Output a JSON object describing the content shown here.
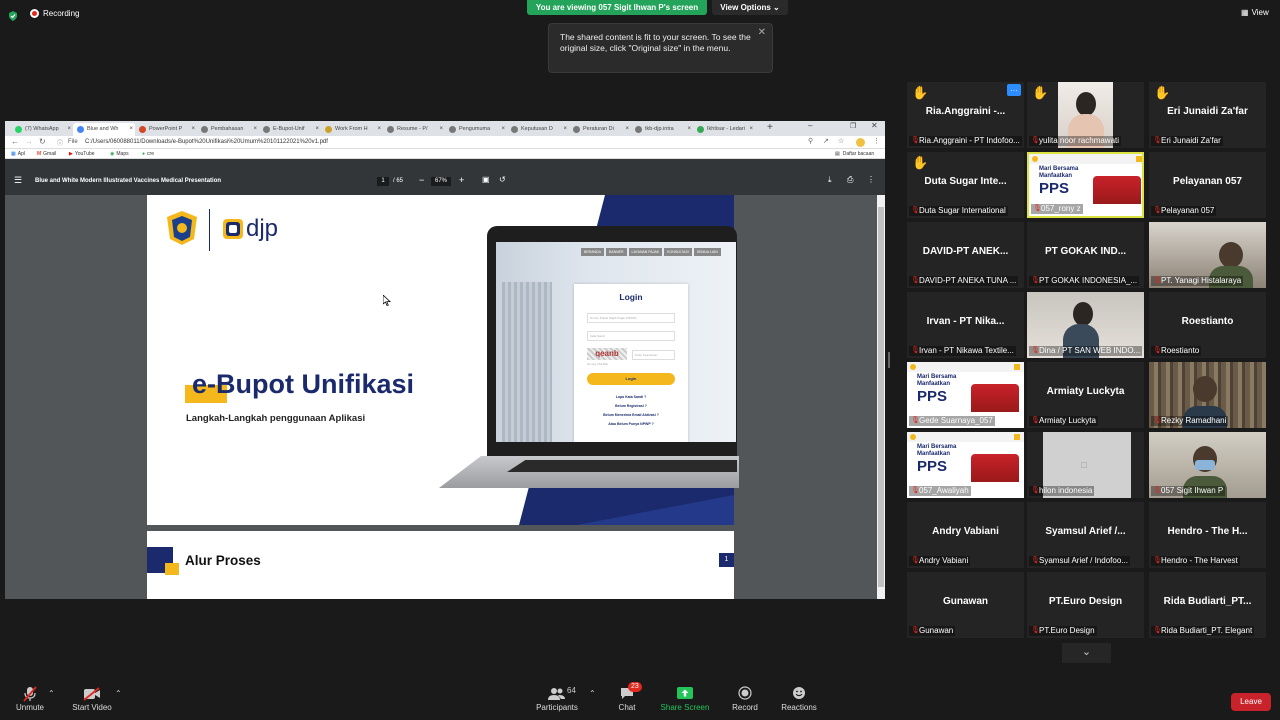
{
  "top": {
    "recording": "Recording",
    "viewing_banner": "You are viewing 057 Sigit Ihwan P's screen",
    "view_options": "View Options",
    "view": "View",
    "tooltip": "The shared content is fit to your screen. To see the original size, click \"Original size\" in the menu."
  },
  "browser": {
    "tabs": [
      "(7) WhatsApp",
      "Blue and Wh",
      "PowerPoint P",
      "Pembahasan",
      "E-Bupot-Unif",
      "Work From H",
      "Resume - P/",
      "Pengumuma",
      "Keputusan D",
      "Peraturan Di",
      "tkb-djp.intra",
      "Ikhtisar - Ledari"
    ],
    "url_prefix": "File",
    "url": "C:/Users/060088011/Downloads/e-Bupot%20Unifikasi%20Umum%20101122021%20v1.pdf",
    "bookmarks": [
      "Apl",
      "Gmail",
      "YouTube",
      "Maps",
      "cre"
    ],
    "reading_list": "Daftar bacaan",
    "pdf_title": "Blue and White Modern Illustrated Vaccines Medical Presentation",
    "page_current": "1",
    "page_total": "/ 65",
    "zoom": "67%"
  },
  "slide1": {
    "brand": "djp",
    "title": "e-Bupot Unifikasi",
    "subtitle": "Langkah-Langkah penggunaan Aplikasi",
    "login_title": "Login",
    "npwp_placeholder": "Nomor Pokok Wajib Pajak (NPWP)",
    "password_placeholder": "Kata Sandi",
    "captcha": "qeanb",
    "captcha_placeholder": "Kode Keamanan",
    "captcha_note": "Ak Lang Lihat Baik",
    "login_button": "Login",
    "links": [
      "Lupa Kata Sandi ?",
      "Belum Registrasi ?",
      "Belum Menerima Email Aktivasi ?",
      "Atau Belum Punya NPWP ?"
    ],
    "nav_items": [
      "BERANDA",
      "BANNER",
      "LAYANAN PAJAK",
      "KONSULTASI",
      "SEMUA LAIN"
    ]
  },
  "slide2": {
    "title": "Alur Proses",
    "badge": "1"
  },
  "participants": [
    {
      "name": "Ria.Anggraini -...",
      "label": "Ria.Anggraini - PT Indofoo...",
      "hand": true
    },
    {
      "name": "",
      "label": "yulita noor rachmawati",
      "hand": true,
      "video": "person"
    },
    {
      "name": "Eri Junaidi Za'far",
      "label": "Eri Junaidi Za'far",
      "hand": true
    },
    {
      "name": "Duta Sugar Inte...",
      "label": "Duta Sugar International",
      "hand": true
    },
    {
      "name": "",
      "label": "057_rony z",
      "video": "pps",
      "highlight": true
    },
    {
      "name": "Pelayanan 057",
      "label": "Pelayanan 057"
    },
    {
      "name": "DAVID-PT ANEK...",
      "label": "DAVID-PT ANEKA TUNA ..."
    },
    {
      "name": "PT GOKAK IND...",
      "label": "PT GOKAK INDONESIA_..."
    },
    {
      "name": "",
      "label": "PT. Yanagi Histalaraya",
      "video": "room"
    },
    {
      "name": "Irvan - PT Nika...",
      "label": "Irvan - PT Nikawa Textile..."
    },
    {
      "name": "",
      "label": "Dina / PT SAN WEB INDO...",
      "video": "person2"
    },
    {
      "name": "Roestianto",
      "label": "Roestianto"
    },
    {
      "name": "",
      "label": "Gede Suarnaya_057",
      "video": "pps"
    },
    {
      "name": "Armiaty Luckyta",
      "label": "Armiaty Luckyta"
    },
    {
      "name": "",
      "label": "Rezky Ramadhani",
      "video": "books"
    },
    {
      "name": "",
      "label": "057_Awaliyah",
      "video": "pps"
    },
    {
      "name": "",
      "label": "hilon indonesia",
      "video": "off"
    },
    {
      "name": "",
      "label": "057 Sigit Ihwan P",
      "video": "mask"
    },
    {
      "name": "Andry Vabiani",
      "label": "Andry Vabiani"
    },
    {
      "name": "Syamsul Arief /...",
      "label": "Syamsul Arief / Indofoo..."
    },
    {
      "name": "Hendro - The H...",
      "label": "Hendro - The Harvest"
    },
    {
      "name": "Gunawan",
      "label": "Gunawan"
    },
    {
      "name": "PT.Euro Design",
      "label": "PT.Euro Design"
    },
    {
      "name": "Rida Budiarti_PT...",
      "label": "Rida Budiarti_PT. Elegant"
    }
  ],
  "pps": {
    "line1": "Mari Bersama",
    "line2": "Manfaatkan",
    "big": "PPS"
  },
  "bottom": {
    "unmute": "Unmute",
    "start_video": "Start Video",
    "participants": "Participants",
    "participants_count": "64",
    "chat": "Chat",
    "chat_badge": "23",
    "share_screen": "Share Screen",
    "record": "Record",
    "reactions": "Reactions",
    "leave": "Leave"
  },
  "colors": {
    "green": "#23a45a",
    "red": "#e0281f",
    "navy": "#1a2a6c",
    "yellow": "#f5b81c",
    "highlight": "#dbe343"
  }
}
